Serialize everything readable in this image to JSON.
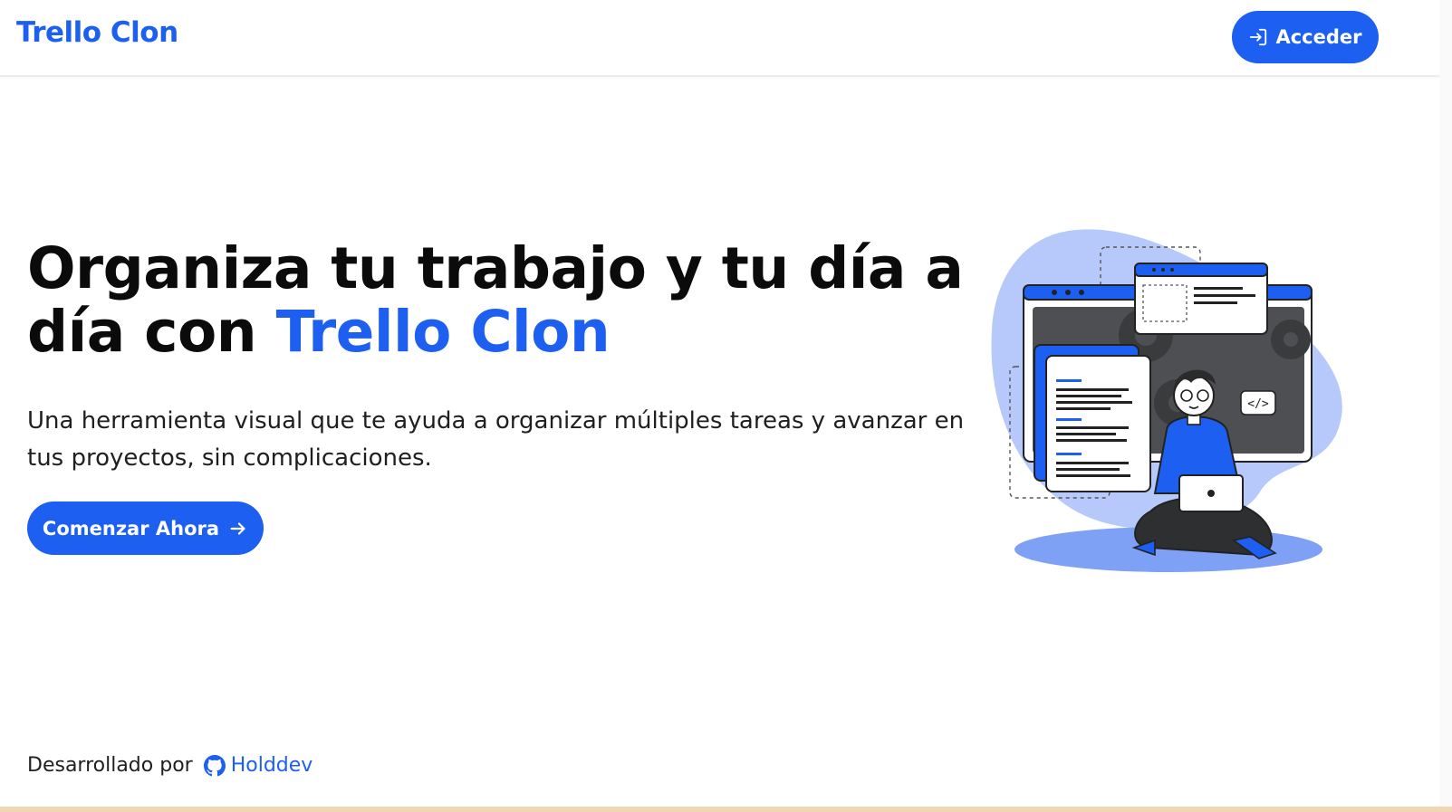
{
  "header": {
    "brand": "Trello Clon",
    "login_label": "Acceder"
  },
  "hero": {
    "headline_prefix": "Organiza tu trabajo y tu día a día con ",
    "headline_accent": "Trello Clon",
    "subtitle": "Una herramienta visual que te ayuda a organizar múltiples tareas y avanzar en tus proyectos, sin complicaciones.",
    "cta_label": "Comenzar Ahora"
  },
  "illustration": {
    "code_tag": "</>"
  },
  "footer": {
    "credit_text": "Desarrollado por",
    "author_link": "Holddev"
  },
  "colors": {
    "accent": "#1d5ff0",
    "text": "#0b0b0b"
  },
  "icons": {
    "login": "login-arrow-icon",
    "cta": "arrow-right-icon",
    "footer": "github-icon"
  }
}
